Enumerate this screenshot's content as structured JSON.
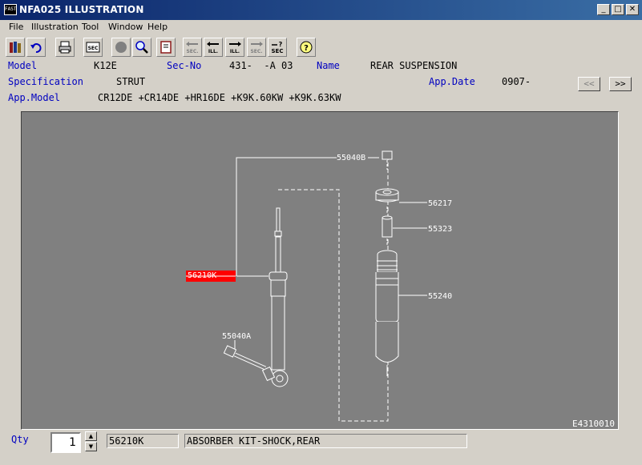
{
  "window": {
    "title": "NFA025 ILLUSTRATION",
    "app_icon_text": "FAST",
    "minimize": "_",
    "maximize": "□",
    "close": "✕"
  },
  "menu": [
    "File",
    "Illustration",
    "Tool",
    "Window",
    "Help"
  ],
  "toolbar_icons": [
    "books-icon",
    "undo-icon",
    "print-icon",
    "sec-icon",
    "circle-icon",
    "zoom-icon",
    "book-icon",
    "prev-sec-icon",
    "prev-ill-icon",
    "next-ill-icon",
    "next-sec-icon",
    "sec-search-icon",
    "help-icon"
  ],
  "info": {
    "model_label": "Model",
    "model_value": "K12E",
    "secno_label": "Sec-No",
    "secno_value": "431-  -A 03",
    "name_label": "Name",
    "name_value": "REAR SUSPENSION",
    "spec_label": "Specification",
    "spec_value": "STRUT",
    "appdate_label": "App.Date",
    "appdate_value": "0907-",
    "appmodel_label": "App.Model",
    "appmodel_value": "CR12DE +CR14DE +HR16DE +K9K.60KW +K9K.63KW",
    "prev_btn": "<<",
    "next_btn": ">>"
  },
  "illustration": {
    "parts": {
      "p55040B": "55040B",
      "p56217": "56217",
      "p55323": "55323",
      "p56210K": "56210K",
      "p55240": "55240",
      "p55040A": "55040A"
    },
    "selected_part": "56210K",
    "figure_id": "E4310010"
  },
  "footer": {
    "qty_label": "Qty",
    "qty_value": "1",
    "spin_up": "▲",
    "spin_down": "▼",
    "part_no": "56210K",
    "description": "ABSORBER KIT-SHOCK,REAR"
  }
}
